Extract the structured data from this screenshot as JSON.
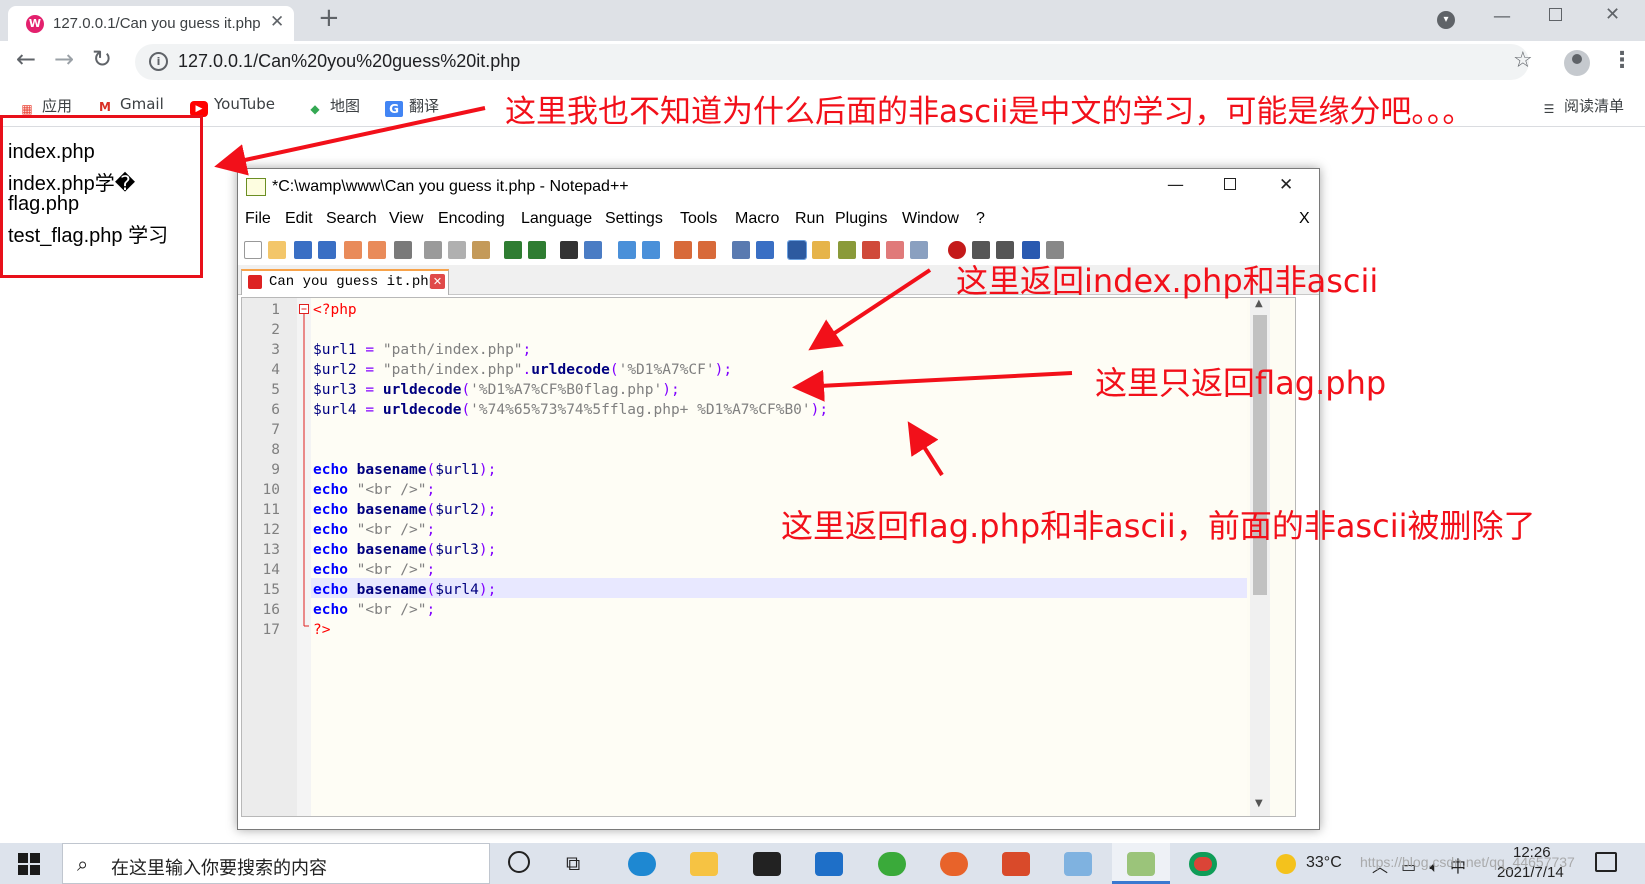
{
  "browser": {
    "tab_title": "127.0.0.1/Can you guess it.php",
    "url": "127.0.0.1/Can%20you%20guess%20it.php",
    "bookmarks": [
      {
        "label": "应用",
        "icon": "apps-grid-icon",
        "color": "#ea4335"
      },
      {
        "label": "Gmail",
        "icon": "gmail-icon",
        "color": "#d93025"
      },
      {
        "label": "YouTube",
        "icon": "youtube-icon",
        "color": "#ff0000"
      },
      {
        "label": "地图",
        "icon": "maps-icon",
        "color": "#34a853"
      },
      {
        "label": "翻译",
        "icon": "translate-icon",
        "color": "#4285f4"
      }
    ],
    "reading_list": "阅读清单"
  },
  "page": {
    "output_lines": [
      "index.php",
      "index.php学�",
      "flag.php",
      "test_flag.php 学习"
    ]
  },
  "annotations": {
    "top": "这里我也不知道为什么后面的非ascii是中文的学习，可能是缘分吧。。。",
    "url2": "这里返回index.php和非ascii",
    "url3": "这里只返回flag.php",
    "url4": "这里返回flag.php和非ascii，前面的非ascii被删除了",
    "accent_color": "#f2101a"
  },
  "notepad": {
    "title": "*C:\\wamp\\www\\Can you guess it.php - Notepad++",
    "menu": [
      "File",
      "Edit",
      "Search",
      "View",
      "Encoding",
      "Language",
      "Settings",
      "Tools",
      "Macro",
      "Run",
      "Plugins",
      "Window",
      "?"
    ],
    "menu_close": "X",
    "tab_label": "Can you guess it.php",
    "line_numbers": [
      "1",
      "2",
      "3",
      "4",
      "5",
      "6",
      "7",
      "8",
      "9",
      "10",
      "11",
      "12",
      "13",
      "14",
      "15",
      "16",
      "17"
    ],
    "code": {
      "l1": "<?php",
      "l3_var": "$url1",
      "l3_str": "\"path/index.php\"",
      "l4_var": "$url2",
      "l4_str": "\"path/index.php\"",
      "l4_fn": "urldecode",
      "l4_arg": "'%D1%A7%CF'",
      "l5_var": "$url3",
      "l5_fn": "urldecode",
      "l5_arg": "'%D1%A7%CF%B0flag.php'",
      "l6_var": "$url4",
      "l6_fn": "urldecode",
      "l6_arg": "'%74%65%73%74%5fflag.php+ %D1%A7%CF%B0'",
      "echo": "echo",
      "basename": "basename",
      "br": "\"<br />\"",
      "l9_var": "$url1",
      "l11_var": "$url2",
      "l13_var": "$url3",
      "l15_var": "$url4",
      "l17": "?>"
    }
  },
  "taskbar": {
    "search_placeholder": "在这里输入你要搜索的内容",
    "temperature": "33°C",
    "ime": "中",
    "time": "12:26",
    "date": "2021/7/14"
  },
  "watermark": "https://blog.csdn.net/qq_44657737"
}
